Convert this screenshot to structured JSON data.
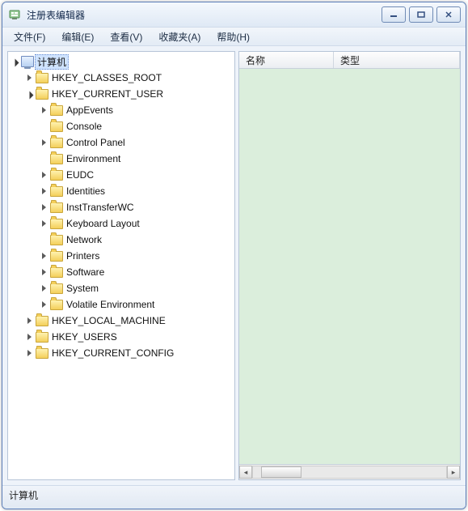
{
  "window": {
    "title": "注册表编辑器"
  },
  "menus": {
    "file": "文件(F)",
    "edit": "编辑(E)",
    "view": "查看(V)",
    "favorites": "收藏夹(A)",
    "help": "帮助(H)"
  },
  "columns": {
    "name": "名称",
    "type": "类型"
  },
  "status": {
    "path": "计算机"
  },
  "tree": {
    "root": {
      "label": "计算机",
      "expanded": true,
      "icon": "computer",
      "children": [
        {
          "label": "HKEY_CLASSES_ROOT",
          "expanded": false,
          "hasChildren": true
        },
        {
          "label": "HKEY_CURRENT_USER",
          "expanded": true,
          "hasChildren": true,
          "children": [
            {
              "label": "AppEvents",
              "hasChildren": true
            },
            {
              "label": "Console",
              "hasChildren": false
            },
            {
              "label": "Control Panel",
              "hasChildren": true
            },
            {
              "label": "Environment",
              "hasChildren": false
            },
            {
              "label": "EUDC",
              "hasChildren": true
            },
            {
              "label": "Identities",
              "hasChildren": true
            },
            {
              "label": "InstTransferWC",
              "hasChildren": true
            },
            {
              "label": "Keyboard Layout",
              "hasChildren": true
            },
            {
              "label": "Network",
              "hasChildren": false
            },
            {
              "label": "Printers",
              "hasChildren": true
            },
            {
              "label": "Software",
              "hasChildren": true
            },
            {
              "label": "System",
              "hasChildren": true
            },
            {
              "label": "Volatile Environment",
              "hasChildren": true
            }
          ]
        },
        {
          "label": "HKEY_LOCAL_MACHINE",
          "expanded": false,
          "hasChildren": true
        },
        {
          "label": "HKEY_USERS",
          "expanded": false,
          "hasChildren": true
        },
        {
          "label": "HKEY_CURRENT_CONFIG",
          "expanded": false,
          "hasChildren": true
        }
      ]
    }
  }
}
